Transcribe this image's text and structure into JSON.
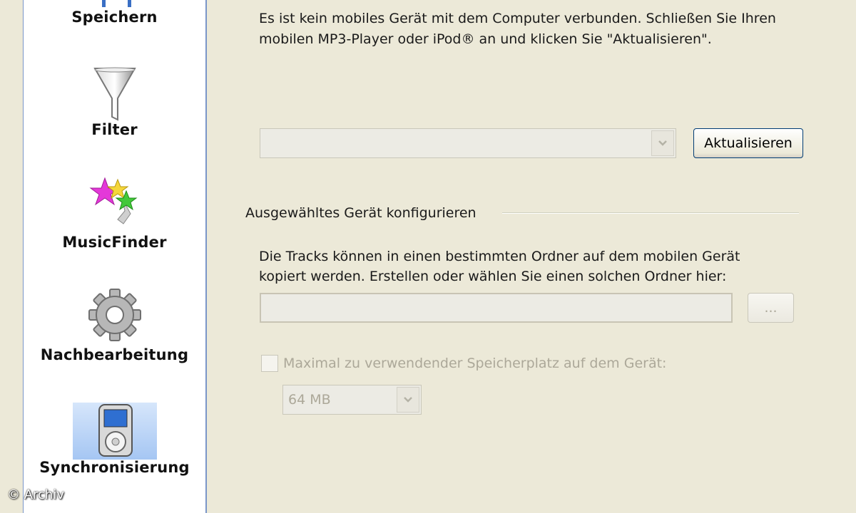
{
  "sidebar": {
    "items": [
      {
        "label": "Speichern",
        "icon": "save-icon"
      },
      {
        "label": "Filter",
        "icon": "funnel-icon"
      },
      {
        "label": "MusicFinder",
        "icon": "stars-icon"
      },
      {
        "label": "Nachbearbeitung",
        "icon": "gear-icon"
      },
      {
        "label": "Synchronisierung",
        "icon": "mp3-player-icon",
        "selected": true
      }
    ]
  },
  "main": {
    "info_text_line1": "Es ist kein mobiles Gerät mit dem Computer verbunden. Schließen Sie Ihren",
    "info_text_line2": "mobilen MP3-Player oder iPod® an und klicken Sie \"Aktualisieren\".",
    "device_select_value": "",
    "refresh_button": "Aktualisieren",
    "config_group_title": "Ausgewähltes Gerät konfigurieren",
    "folder_text_line1": "Die Tracks können in einen bestimmten Ordner auf dem mobilen Gerät",
    "folder_text_line2": "kopiert werden. Erstellen oder wählen Sie einen solchen Ordner hier:",
    "folder_input_value": "",
    "browse_button": "...",
    "max_storage_label": "Maximal zu verwendender Speicherplatz auf dem Gerät:",
    "max_storage_checked": false,
    "storage_size_value": "64 MB"
  },
  "watermark": "© Archiv",
  "colors": {
    "background": "#ece9d8",
    "sidebar_border": "#7a96c9",
    "selected_item": "#a5c6f3",
    "disabled_text": "#aca899"
  }
}
